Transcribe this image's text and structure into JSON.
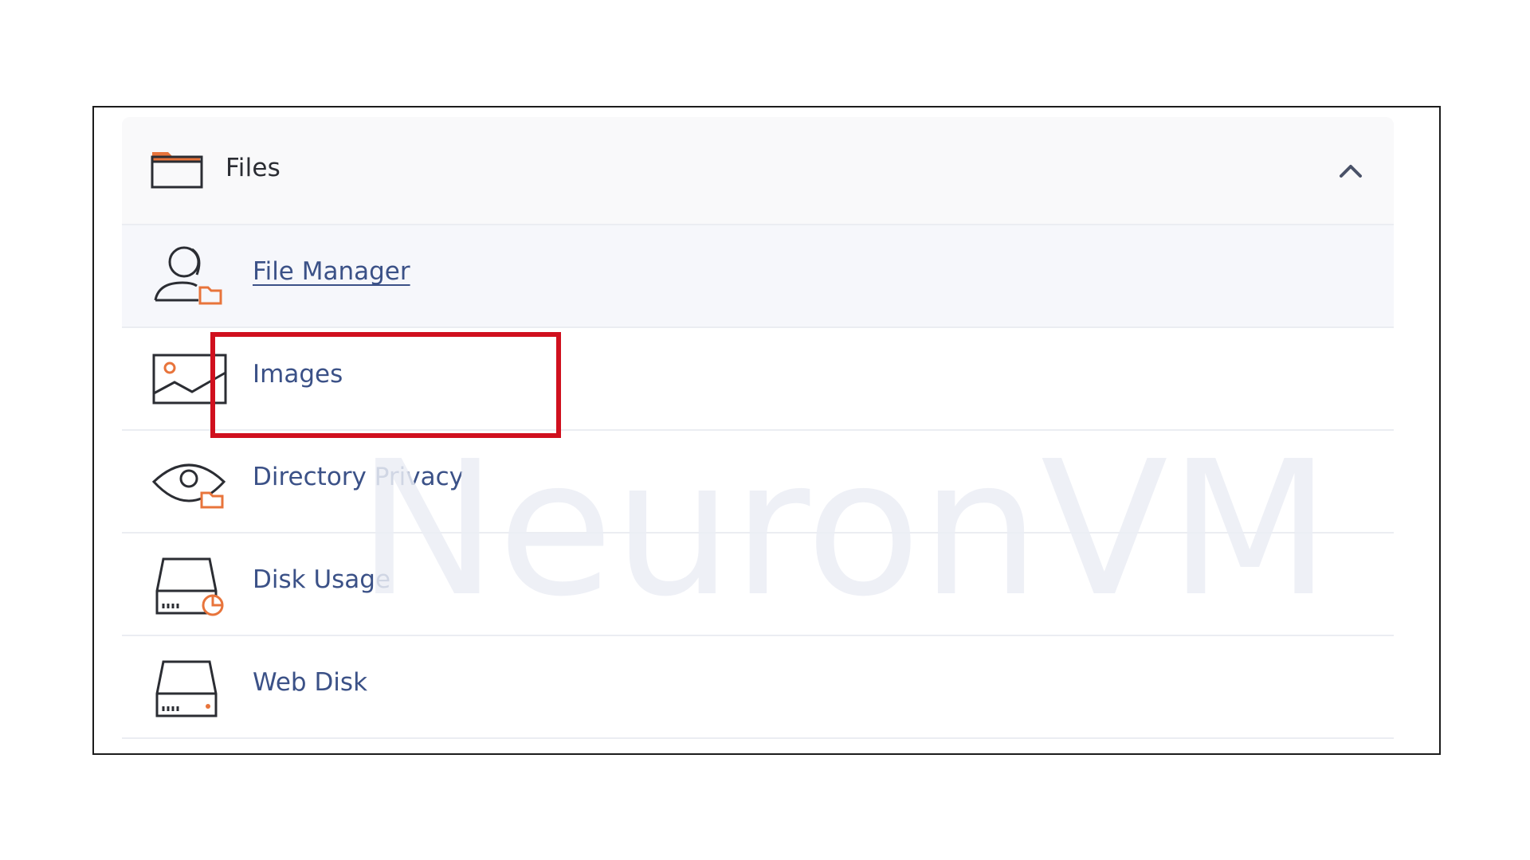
{
  "panel": {
    "title": "Files",
    "header_icon": "folder-icon",
    "collapse_icon": "chevron-up-icon",
    "items": [
      {
        "label": "File Manager",
        "icon": "file-manager-icon",
        "active": true
      },
      {
        "label": "Images",
        "icon": "image-icon",
        "active": false
      },
      {
        "label": "Directory Privacy",
        "icon": "eye-folder-icon",
        "active": false
      },
      {
        "label": "Disk Usage",
        "icon": "disk-usage-icon",
        "active": false
      },
      {
        "label": "Web Disk",
        "icon": "hard-drive-icon",
        "active": false
      }
    ]
  },
  "watermark": {
    "text": "NeuronVM"
  },
  "colors": {
    "accent_orange": "#e8743b",
    "link_blue": "#3b5187",
    "highlight_red": "#d0101e",
    "icon_dark": "#2b2d33"
  }
}
